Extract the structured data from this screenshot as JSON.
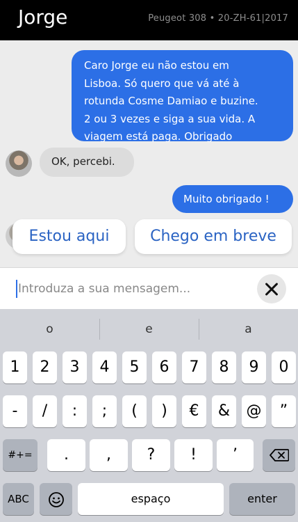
{
  "header": {
    "driver_name": "Jorge",
    "vehicle_info": "Peugeot 308 • 20-ZH-61|2017"
  },
  "messages": {
    "outgoing_1": "Caro Jorge eu não estou em\nLisboa. Só quero que vá até à\nrotunda Cosme Damiao e buzine.\n2 ou 3 vezes e siga a sua vida. A\nviagem está paga. Obrigado",
    "incoming_1": "OK, percebi.",
    "outgoing_2": "Muito obrigado !"
  },
  "quick_replies": [
    "Estou aqui",
    "Chego em breve"
  ],
  "input": {
    "placeholder": "Introduza a sua mensagem..."
  },
  "keyboard": {
    "suggestions": [
      "o",
      "e",
      "a"
    ],
    "row1": [
      "1",
      "2",
      "3",
      "4",
      "5",
      "6",
      "7",
      "8",
      "9",
      "0"
    ],
    "row2": [
      "-",
      "/",
      ":",
      ";",
      "(",
      ")",
      "€",
      "&",
      "@",
      "”"
    ],
    "row3": {
      "shift": "#+=",
      "keys": [
        ".",
        ",",
        "?",
        "!",
        "’"
      ]
    },
    "row4": {
      "abc": "ABC",
      "space": "espaço",
      "enter": "enter"
    }
  },
  "colors": {
    "outgoing_bubble": "#2c6fe6",
    "incoming_bubble": "#dcdcdc",
    "quick_reply_text": "#2a63c3",
    "header_bg": "#000000",
    "keyboard_bg": "#d1d3d9"
  }
}
